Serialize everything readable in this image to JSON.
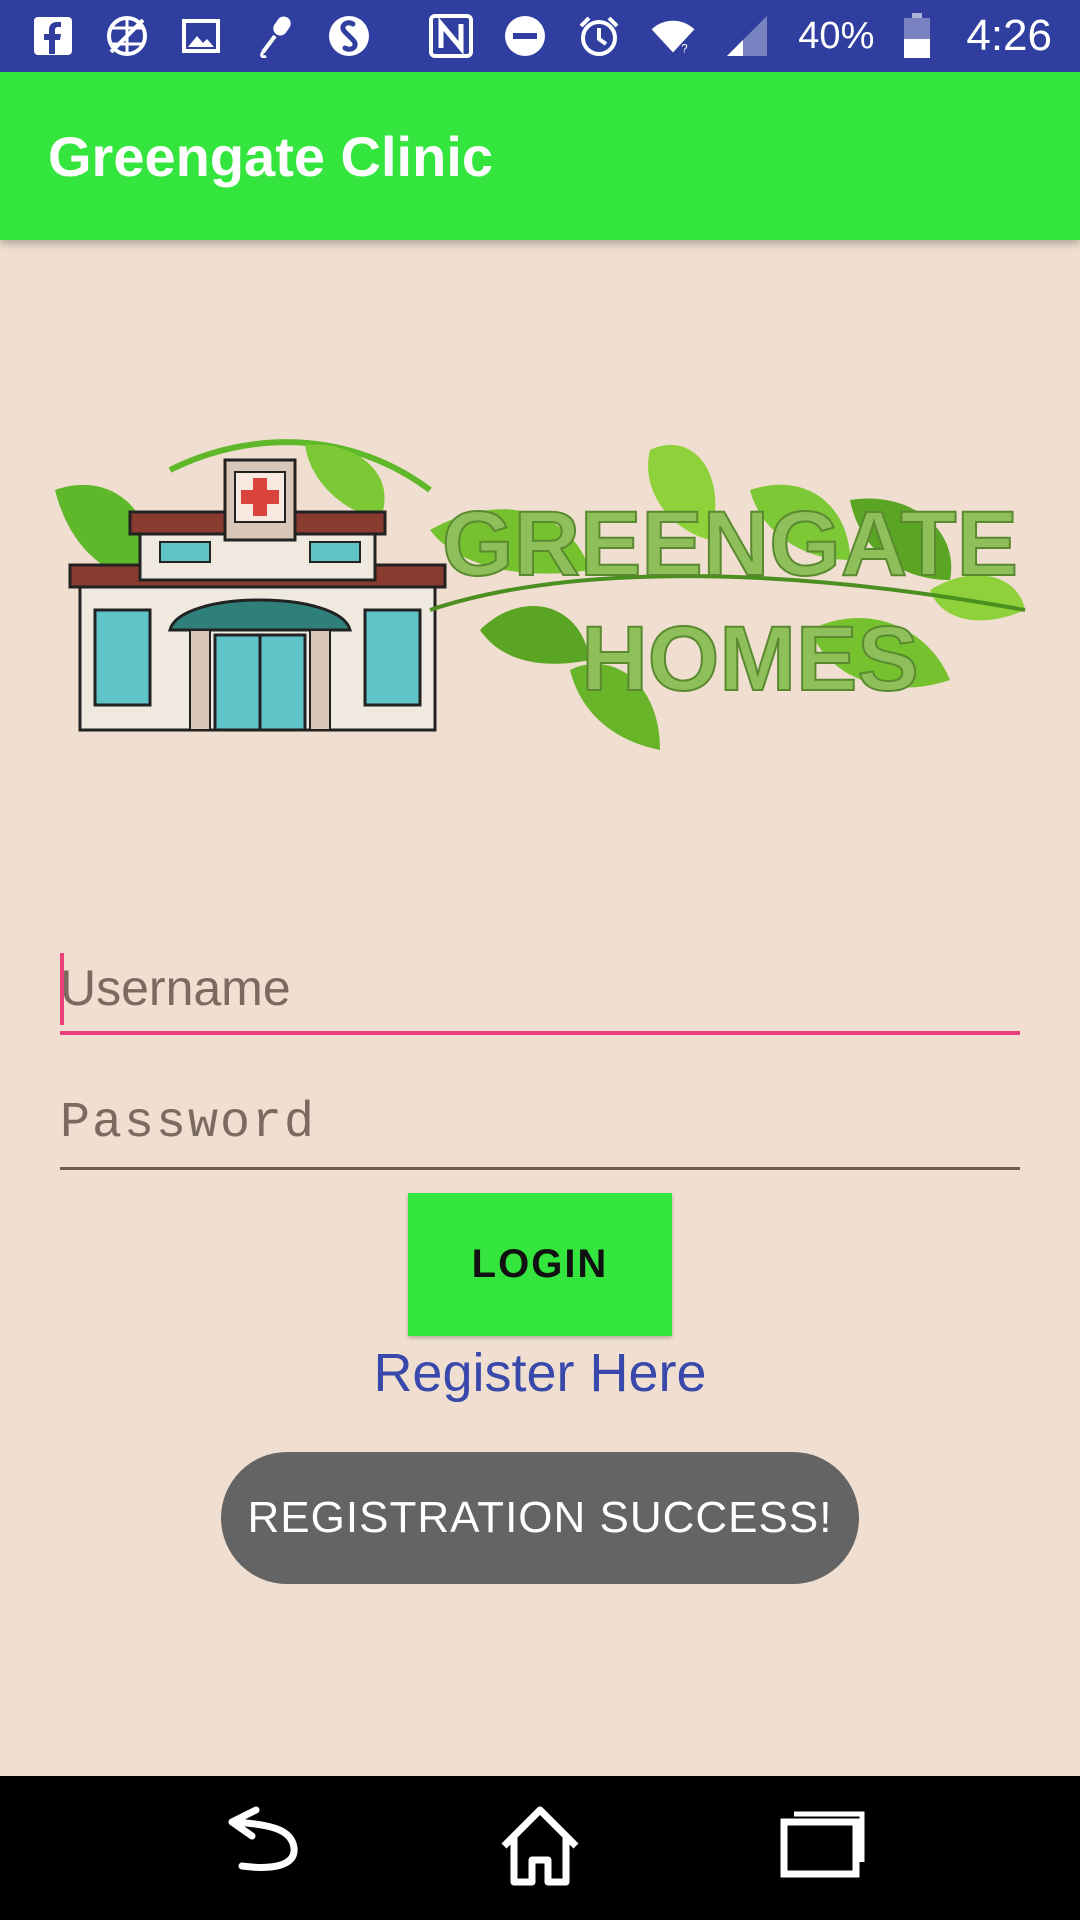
{
  "status_bar": {
    "battery": "40%",
    "time": "4:26",
    "icons_left": [
      "facebook-icon",
      "no-network-icon",
      "image-icon",
      "microphone-icon",
      "shazam-icon"
    ],
    "icons_right": [
      "nfc-icon",
      "do-not-disturb-icon",
      "alarm-icon",
      "wifi-icon",
      "signal-icon",
      "battery-icon"
    ]
  },
  "app_bar": {
    "title": "Greengate Clinic"
  },
  "logo": {
    "line1": "GREENGATE",
    "line2": "HOMES"
  },
  "form": {
    "username_placeholder": "Username",
    "username_value": "",
    "password_placeholder": "Password",
    "password_value": "",
    "login_label": "LOGIN",
    "register_label": "Register Here"
  },
  "toast": {
    "message": "REGISTRATION SUCCESS!"
  },
  "nav_bar": {
    "buttons": [
      "back-icon",
      "home-icon",
      "recents-icon"
    ]
  },
  "colors": {
    "status_bar": "#303f9f",
    "app_bar": "#33e53d",
    "background": "#f0dfd0",
    "accent": "#ec407a",
    "link": "#3949ab",
    "toast": "#646464"
  }
}
